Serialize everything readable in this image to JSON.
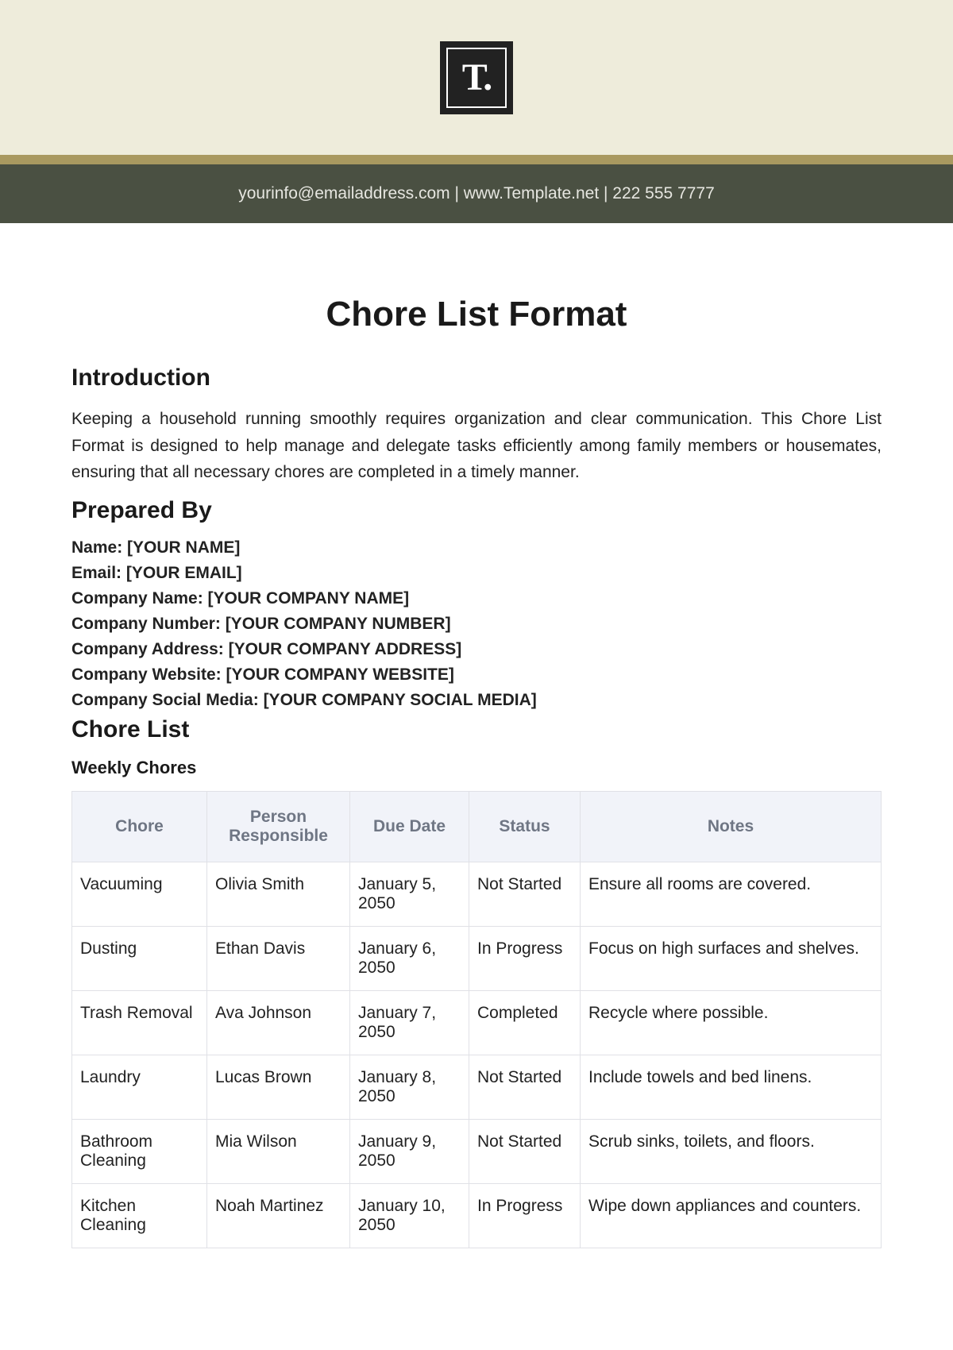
{
  "header": {
    "logo_text": "T.",
    "contact_line": "yourinfo@emailaddress.com  |  www.Template.net  |  222 555 7777"
  },
  "title": "Chore List Format",
  "introduction_heading": "Introduction",
  "introduction_text": "Keeping a household running smoothly requires organization and clear communication. This Chore List Format is designed to help manage and delegate tasks efficiently among family members or housemates, ensuring that all necessary chores are completed in a timely manner.",
  "prepared_by": {
    "heading": "Prepared By",
    "fields": [
      {
        "label": "Name:",
        "value": "[YOUR NAME]"
      },
      {
        "label": "Email:",
        "value": "[YOUR EMAIL]"
      },
      {
        "label": "Company Name:",
        "value": "[YOUR COMPANY NAME]"
      },
      {
        "label": "Company Number:",
        "value": "[YOUR COMPANY NUMBER]"
      },
      {
        "label": "Company Address:",
        "value": "[YOUR COMPANY ADDRESS]"
      },
      {
        "label": "Company Website:",
        "value": "[YOUR COMPANY WEBSITE]"
      },
      {
        "label": "Company Social Media:",
        "value": "[YOUR COMPANY SOCIAL MEDIA]"
      }
    ]
  },
  "chore_list": {
    "heading": "Chore List",
    "weekly_heading": "Weekly Chores",
    "columns": [
      "Chore",
      "Person Responsible",
      "Due Date",
      "Status",
      "Notes"
    ],
    "rows": [
      {
        "chore": "Vacuuming",
        "person": "Olivia Smith",
        "due": "January 5, 2050",
        "status": "Not Started",
        "notes": "Ensure all rooms are covered."
      },
      {
        "chore": "Dusting",
        "person": "Ethan Davis",
        "due": "January 6, 2050",
        "status": "In Progress",
        "notes": "Focus on high surfaces and shelves."
      },
      {
        "chore": "Trash Removal",
        "person": "Ava Johnson",
        "due": "January 7, 2050",
        "status": "Completed",
        "notes": "Recycle where possible."
      },
      {
        "chore": "Laundry",
        "person": "Lucas Brown",
        "due": "January 8, 2050",
        "status": "Not Started",
        "notes": "Include towels and bed linens."
      },
      {
        "chore": "Bathroom Cleaning",
        "person": "Mia Wilson",
        "due": "January 9, 2050",
        "status": "Not Started",
        "notes": "Scrub sinks, toilets, and floors."
      },
      {
        "chore": "Kitchen Cleaning",
        "person": "Noah Martinez",
        "due": "January 10, 2050",
        "status": "In Progress",
        "notes": "Wipe down appliances and counters."
      }
    ]
  }
}
